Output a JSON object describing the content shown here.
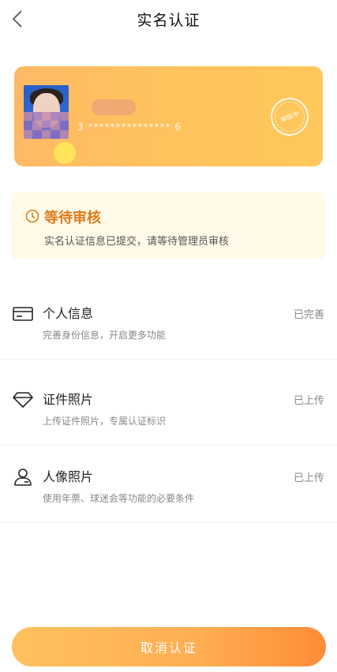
{
  "header": {
    "title": "实名认证"
  },
  "id_card": {
    "number": "3 *************** 6",
    "stamp": "审核中"
  },
  "status": {
    "title": "等待审核",
    "description": "实名认证信息已提交，请等待管理员审核",
    "accent_color": "#e07a1a"
  },
  "items": [
    {
      "label": "个人信息",
      "subtitle": "完善身份信息，开启更多功能",
      "state": "已完善",
      "icon": "id-card-icon"
    },
    {
      "label": "证件照片",
      "subtitle": "上传证件照片，专属认证标识",
      "state": "已上传",
      "icon": "diamond-icon"
    },
    {
      "label": "人像照片",
      "subtitle": "使用年票、球迷会等功能的必要条件",
      "state": "已上传",
      "icon": "user-icon"
    }
  ],
  "actions": {
    "cancel_label": "取消认证"
  }
}
